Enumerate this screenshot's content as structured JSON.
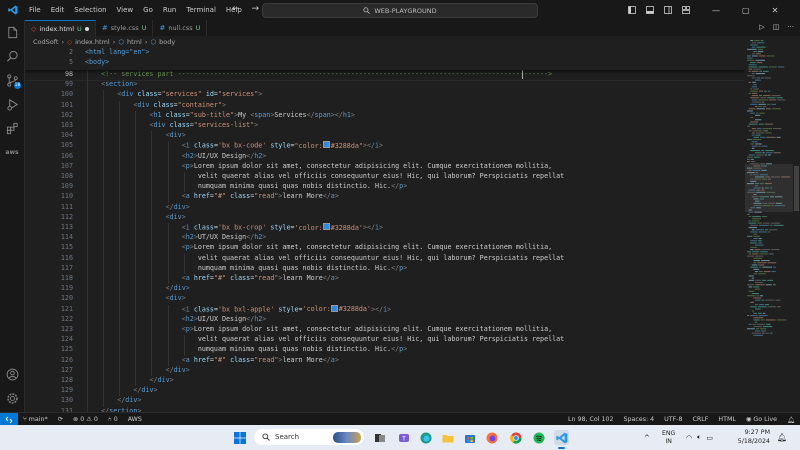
{
  "titlebar": {
    "menu": [
      "File",
      "Edit",
      "Selection",
      "View",
      "Go",
      "Run",
      "Terminal",
      "Help"
    ],
    "search_text": "WEB-PLAYGROUND",
    "window_controls": [
      "minimize-icon",
      "maximize-icon",
      "close-icon"
    ]
  },
  "activitybar": {
    "items": [
      "files-icon",
      "search-icon",
      "source-control-icon",
      "run-debug-icon",
      "extensions-icon",
      "aws-icon"
    ],
    "source_control_badge": "18",
    "aws_label": "aws",
    "bottom": [
      "account-icon",
      "settings-gear-icon"
    ]
  },
  "tabs": [
    {
      "name": "index.html",
      "mod": "U",
      "dirty": true
    },
    {
      "name": "style.css",
      "mod": "U"
    },
    {
      "name": "null.css",
      "mod": "U"
    }
  ],
  "breadcrumb": [
    "CodSoft",
    "index.html",
    "html",
    "body"
  ],
  "sticky": [
    {
      "num": "2",
      "text": "<html lang=\"en\">"
    },
    {
      "num": "5",
      "text": "<body>"
    }
  ],
  "code": [
    {
      "num": "98",
      "indent": 2,
      "html": "<span class='c'>&lt;!-- services part --------------------------------------------------------------------------------------------&gt;</span>"
    },
    {
      "num": "99",
      "indent": 2,
      "html": "<span class='p'>&lt;</span><span class='t'>section</span><span class='p'>&gt;</span>"
    },
    {
      "num": "100",
      "indent": 4,
      "html": "<span class='p'>&lt;</span><span class='t'>div</span> <span class='a'>class</span>=<span class='s'>\"services\"</span> <span class='a'>id</span>=<span class='s'>\"services\"</span><span class='p'>&gt;</span>"
    },
    {
      "num": "101",
      "indent": 6,
      "html": "<span class='p'>&lt;</span><span class='t'>div</span> <span class='a'>class</span>=<span class='s'>\"container\"</span><span class='p'>&gt;</span>"
    },
    {
      "num": "102",
      "indent": 8,
      "html": "<span class='p'>&lt;</span><span class='t'>h1</span> <span class='a'>class</span>=<span class='s'>\"sub-title\"</span><span class='p'>&gt;</span>My <span class='p'>&lt;</span><span class='t'>span</span><span class='p'>&gt;</span>Services<span class='p'>&lt;/</span><span class='t'>span</span><span class='p'>&gt;&lt;/</span><span class='t'>h1</span><span class='p'>&gt;</span>"
    },
    {
      "num": "103",
      "indent": 8,
      "html": "<span class='p'>&lt;</span><span class='t'>div</span> <span class='a'>class</span>=<span class='s'>\"services-list\"</span><span class='p'>&gt;</span>"
    },
    {
      "num": "104",
      "indent": 10,
      "html": "<span class='p'>&lt;</span><span class='t'>div</span><span class='p'>&gt;</span>"
    },
    {
      "num": "105",
      "indent": 12,
      "html": "<span class='p'>&lt;</span><span class='t'>i</span> <span class='a'>class</span>=<span class='s'>'bx bx-code'</span> <span class='a'>style</span>=<span class='s'>\"color:<span class='sw'></span>#3288da\"</span><span class='p'>&gt;&lt;/</span><span class='t'>i</span><span class='p'>&gt;</span>"
    },
    {
      "num": "106",
      "indent": 12,
      "html": "<span class='p'>&lt;</span><span class='t'>h2</span><span class='p'>&gt;</span>UI/UX Design<span class='p'>&lt;/</span><span class='t'>h2</span><span class='p'>&gt;</span>"
    },
    {
      "num": "107",
      "indent": 12,
      "html": "<span class='p'>&lt;</span><span class='t'>p</span><span class='p'>&gt;</span>Lorem ipsum dolor sit amet, consectetur adipisicing elit. Cumque exercitationem mollitia,"
    },
    {
      "num": "108",
      "indent": 14,
      "html": "velit quaerat alias vel officiis consequuntur eius! Hic, qui laborum? Perspiciatis repellat"
    },
    {
      "num": "109",
      "indent": 14,
      "html": "numquam minima quasi quas nobis distinctio. Hic.<span class='p'>&lt;/</span><span class='t'>p</span><span class='p'>&gt;</span>"
    },
    {
      "num": "110",
      "indent": 12,
      "html": "<span class='p'>&lt;</span><span class='t'>a</span> <span class='a'>href</span>=<span class='s'>\"#\"</span> <span class='a'>class</span>=<span class='s'>\"read\"</span><span class='p'>&gt;</span>learn More<span class='p'>&lt;/</span><span class='t'>a</span><span class='p'>&gt;</span>"
    },
    {
      "num": "111",
      "indent": 10,
      "html": "<span class='p'>&lt;/</span><span class='t'>div</span><span class='p'>&gt;</span>"
    },
    {
      "num": "112",
      "indent": 10,
      "html": "<span class='p'>&lt;</span><span class='t'>div</span><span class='p'>&gt;</span>"
    },
    {
      "num": "113",
      "indent": 12,
      "html": "<span class='p'>&lt;</span><span class='t'>i</span> <span class='a'>class</span>=<span class='s'>'bx bx-crop'</span> <span class='a'>style</span>=<span class='s'>'color:<span class='sw'></span>#3288da'</span><span class='p'>&gt;&lt;/</span><span class='t'>i</span><span class='p'>&gt;</span>"
    },
    {
      "num": "114",
      "indent": 12,
      "html": "<span class='p'>&lt;</span><span class='t'>h2</span><span class='p'>&gt;</span>UT/UX Design<span class='p'>&lt;/</span><span class='t'>h2</span><span class='p'>&gt;</span>"
    },
    {
      "num": "115",
      "indent": 12,
      "html": "<span class='p'>&lt;</span><span class='t'>p</span><span class='p'>&gt;</span>Lorem ipsum dolor sit amet, consectetur adipisicing elit. Cumque exercitationem mollitia,"
    },
    {
      "num": "116",
      "indent": 14,
      "html": "velit quaerat alias vel officiis consequuntur eius! Hic, qui laborum? Perspiciatis repellat"
    },
    {
      "num": "117",
      "indent": 14,
      "html": "numquam minima quasi quas nobis distinctio. Hic.<span class='p'>&lt;/</span><span class='t'>p</span><span class='p'>&gt;</span>"
    },
    {
      "num": "118",
      "indent": 12,
      "html": "<span class='p'>&lt;</span><span class='t'>a</span> <span class='a'>href</span>=<span class='s'>\"#\"</span> <span class='a'>class</span>=<span class='s'>\"read\"</span><span class='p'>&gt;</span>learn More<span class='p'>&lt;/</span><span class='t'>a</span><span class='p'>&gt;</span>"
    },
    {
      "num": "119",
      "indent": 10,
      "html": "<span class='p'>&lt;/</span><span class='t'>div</span><span class='p'>&gt;</span>"
    },
    {
      "num": "120",
      "indent": 10,
      "html": "<span class='p'>&lt;</span><span class='t'>div</span><span class='p'>&gt;</span>"
    },
    {
      "num": "121",
      "indent": 12,
      "html": "<span class='p'>&lt;</span><span class='t'>i</span> <span class='a'>class</span>=<span class='s'>'bx bxl-apple'</span> <span class='a'>style</span>=<span class='s'>'color:<span class='sw'></span>#3288da'</span><span class='p'>&gt;&lt;/</span><span class='t'>i</span><span class='p'>&gt;</span>"
    },
    {
      "num": "122",
      "indent": 12,
      "html": "<span class='p'>&lt;</span><span class='t'>h2</span><span class='p'>&gt;</span>UI/UX Design<span class='p'>&lt;/</span><span class='t'>h2</span><span class='p'>&gt;</span>"
    },
    {
      "num": "123",
      "indent": 12,
      "html": "<span class='p'>&lt;</span><span class='t'>p</span><span class='p'>&gt;</span>Lorem ipsum dolor sit amet, consectetur adipisicing elit. Cumque exercitationem mollitia,"
    },
    {
      "num": "124",
      "indent": 14,
      "html": "velit quaerat alias vel officiis consequuntur eius! Hic, qui laborum? Perspiciatis repellat"
    },
    {
      "num": "125",
      "indent": 14,
      "html": "numquam minima quasi quas nobis distinctio. Hic.<span class='p'>&lt;/</span><span class='t'>p</span><span class='p'>&gt;</span>"
    },
    {
      "num": "126",
      "indent": 12,
      "html": "<span class='p'>&lt;</span><span class='t'>a</span> <span class='a'>href</span>=<span class='s'>\"#\"</span> <span class='a'>class</span>=<span class='s'>\"read\"</span><span class='p'>&gt;</span>learn More<span class='p'>&lt;/</span><span class='t'>a</span><span class='p'>&gt;</span>"
    },
    {
      "num": "127",
      "indent": 10,
      "html": "<span class='p'>&lt;/</span><span class='t'>div</span><span class='p'>&gt;</span>"
    },
    {
      "num": "128",
      "indent": 8,
      "html": "<span class='p'>&lt;/</span><span class='t'>div</span><span class='p'>&gt;</span>"
    },
    {
      "num": "129",
      "indent": 6,
      "html": "<span class='p'>&lt;/</span><span class='t'>div</span><span class='p'>&gt;</span>"
    },
    {
      "num": "130",
      "indent": 4,
      "html": "<span class='p'>&lt;/</span><span class='t'>div</span><span class='p'>&gt;</span>"
    },
    {
      "num": "131",
      "indent": 2,
      "html": "<span class='p'>&lt;/</span><span class='t'>section</span><span class='p'>&gt;</span>"
    },
    {
      "num": "132",
      "indent": 0,
      "html": ""
    }
  ],
  "statusbar": {
    "branch": "main*",
    "sync": "",
    "problems_errors": "0",
    "problems_warnings": "0",
    "ports": "0",
    "aws": "AWS",
    "position": "Ln 98, Col 102",
    "spaces": "Spaces: 4",
    "encoding": "UTF-8",
    "eol": "CRLF",
    "language": "HTML",
    "golive": "Go Live"
  },
  "taskbar": {
    "search": "Search",
    "lang": "ENG",
    "region": "IN",
    "time": "9:27 PM",
    "date": "5/18/2024"
  },
  "colors": {
    "accent": "#0078d4",
    "swatch": "#3288da"
  }
}
